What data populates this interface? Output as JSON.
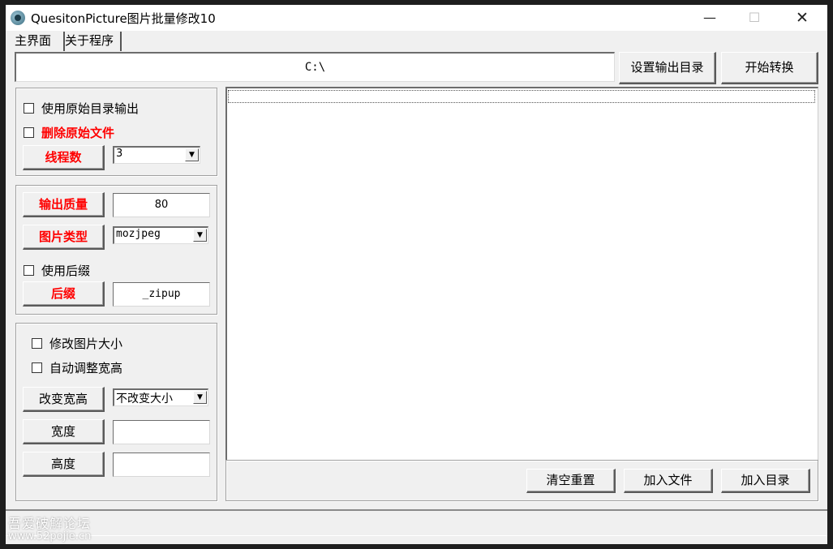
{
  "window": {
    "title": "QuesitonPicture图片批量修改10"
  },
  "tabs": [
    "主界面",
    "关于程序"
  ],
  "output": {
    "path": "C:\\",
    "set_dir_button": "设置输出目录",
    "start_button": "开始转换"
  },
  "group1": {
    "use_orig_dir": "使用原始目录输出",
    "delete_orig": "删除原始文件",
    "threads_button": "线程数",
    "threads_value": "3"
  },
  "group2": {
    "quality_button": "输出质量",
    "quality_value": "80",
    "type_button": "图片类型",
    "type_value": "mozjpeg",
    "use_suffix": "使用后缀",
    "suffix_button": "后缀",
    "suffix_value": "_zipup"
  },
  "group3": {
    "resize": "修改图片大小",
    "auto_adjust": "自动调整宽高",
    "change_wh_button": "改变宽高",
    "change_wh_value": "不改变大小",
    "width_button": "宽度",
    "width_value": "",
    "height_button": "高度",
    "height_value": ""
  },
  "bottom": {
    "clear_button": "清空重置",
    "add_file_button": "加入文件",
    "add_dir_button": "加入目录"
  },
  "watermark": {
    "line1": "吾爱破解论坛",
    "line2": "www.52pojie.cn"
  },
  "colors": {
    "accent_red": "#ff0000",
    "window_bg": "#f0f0f0"
  }
}
